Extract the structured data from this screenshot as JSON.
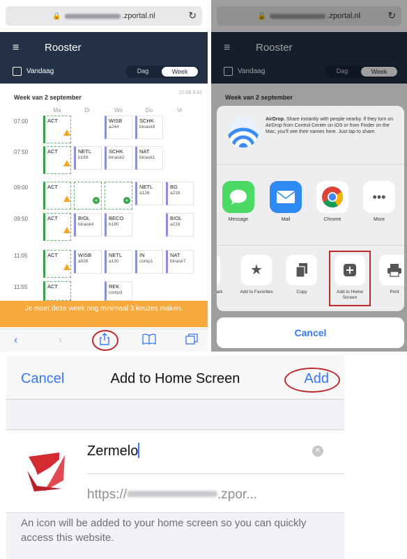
{
  "left": {
    "url_suffix": ".zportal.nl",
    "menu_icon": "≡",
    "app_title": "Rooster",
    "today_label": "Vandaag",
    "seg_day": "Dag",
    "seg_week": "Week",
    "week_header": "Week van 2 september",
    "stamp": "21:08 9:42",
    "days": [
      "Ma",
      "Di",
      "Wo",
      "Do",
      "Vr"
    ],
    "times": [
      "07:00",
      "07:50",
      "09:00",
      "09:50",
      "11:05",
      "11:55"
    ],
    "row1": {
      "c1": "ACT",
      "c3": "WISB",
      "c3s": "a244",
      "c4": "SCHK",
      "c4s": "binask9"
    },
    "row2": {
      "c1": "ACT",
      "c2": "NETL",
      "c2s": "b169",
      "c3": "SCHK",
      "c3s": "binask2",
      "c4": "NAT",
      "c4s": "binask1"
    },
    "row3": {
      "c1": "ACT",
      "c4": "NETL",
      "c4s": "a126",
      "c5": "BG",
      "c5s": "a218"
    },
    "row4": {
      "c1": "ACT",
      "c2": "BIOL",
      "c2s": "binask4",
      "c3": "BECO",
      "c3s": "b180",
      "c5": "BIOL",
      "c5s": "a218"
    },
    "row5": {
      "c1": "ACT",
      "c2": "WISB",
      "c2s": "a028",
      "c3": "NETL",
      "c3s": "a130",
      "c4": "IN",
      "c4s": "comp1",
      "c5": "NAT",
      "c5s": "binask7"
    },
    "row6": {
      "c1": "ACT",
      "c3": "REK",
      "c3s": "comp3"
    },
    "banner": "Je moet deze week nog minimaal 3 keuzes maken.",
    "toolbar_icons": {
      "back": "back-icon",
      "forward": "forward-icon",
      "share": "share-icon",
      "bookmarks": "book-icon",
      "tabs": "tabs-icon"
    }
  },
  "right": {
    "url_suffix": ".zportal.nl",
    "app_title": "Rooster",
    "today_label": "Vandaag",
    "seg_day": "Dag",
    "seg_week": "Week",
    "week_header": "Week van 2 september",
    "airdrop_bold": "AirDrop.",
    "airdrop_text": "Share instantly with people nearby. If they turn on AirDrop from Control Center on iOS or from Finder on the Mac, you'll see their names here. Just tap to share.",
    "apps": [
      "Message",
      "Mail",
      "Chrome",
      "More"
    ],
    "actions": {
      "partial": "ark",
      "favorites": "Add to Favorites",
      "copy": "Copy",
      "home": "Add to Home Screen",
      "print": "Print"
    },
    "cancel": "Cancel"
  },
  "bottom": {
    "cancel": "Cancel",
    "title": "Add to Home Screen",
    "add": "Add",
    "name_value": "Zermelo",
    "url_prefix": "https://",
    "url_suffix": ".zpor...",
    "note": "An icon will be added to your home screen so you can quickly access this website."
  },
  "colors": {
    "appbar": "#233247",
    "banner": "#f7a93b",
    "ios_blue": "#3478f6",
    "highlight": "#c0282c",
    "zermelo_red": "#d42a32"
  }
}
